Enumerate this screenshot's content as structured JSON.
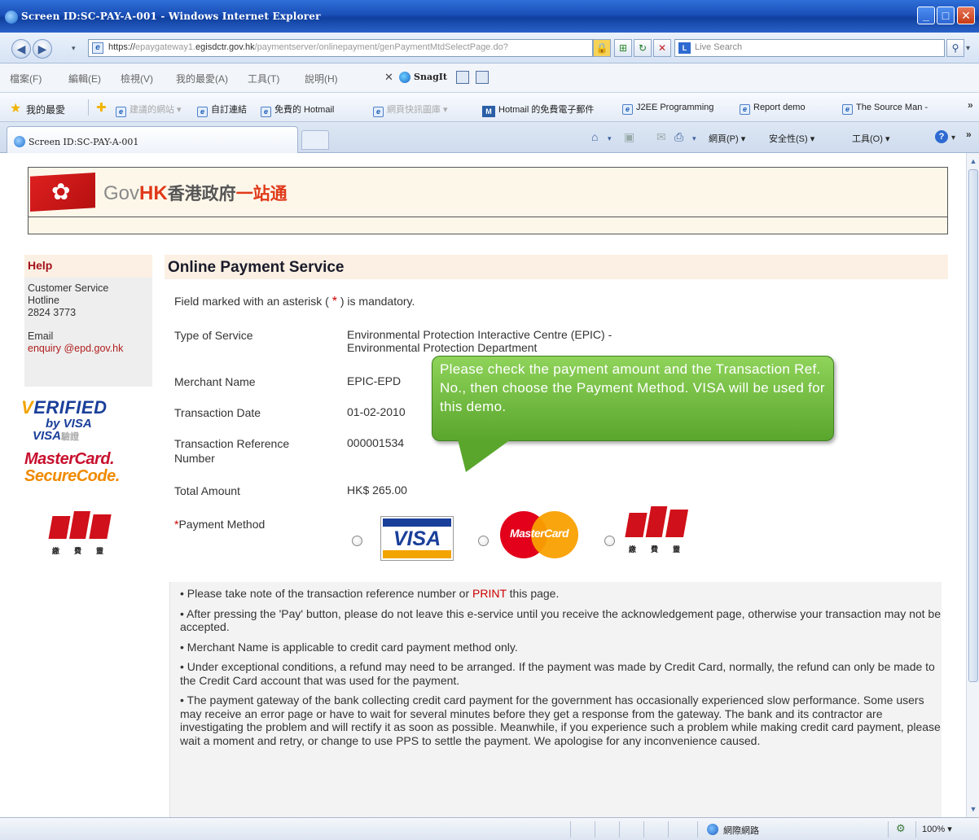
{
  "window": {
    "title": "Screen ID:SC-PAY-A-001 - Windows Internet Explorer"
  },
  "address_bar": {
    "url_prefix": "https://",
    "url_host_dim1": "epaygateway1.",
    "url_host": "egisdctr.gov.hk",
    "url_path": "/paymentserver/onlinepayment/genPaymentMtdSelectPage.do?",
    "search_placeholder": "Live Search"
  },
  "menu": {
    "items": [
      "檔案(F)",
      "編輯(E)",
      "檢視(V)",
      "我的最愛(A)",
      "工具(T)",
      "說明(H)"
    ],
    "snagit_label": "SnagIt"
  },
  "favorites": {
    "root": "我的最愛",
    "items": [
      {
        "label": "建議的網站 ▾",
        "faded": true
      },
      {
        "label": "自訂連結",
        "faded": false
      },
      {
        "label": "免費的 Hotmail",
        "faded": false
      },
      {
        "label": "網頁快訊圖庫 ▾",
        "faded": true
      },
      {
        "label": "Hotmail 的免費電子郵件",
        "faded": false
      },
      {
        "label": "J2EE Programming",
        "faded": false
      },
      {
        "label": "Report demo",
        "faded": false
      },
      {
        "label": "The Source Man -",
        "faded": false
      }
    ]
  },
  "tab": {
    "label": "Screen ID:SC-PAY-A-001"
  },
  "command_bar": {
    "page": "網頁(P) ▾",
    "safety": "安全性(S) ▾",
    "tools": "工具(O) ▾"
  },
  "banner": {
    "logo_gov": "Gov",
    "logo_hk": "HK",
    "logo_cn": "香港政府",
    "logo_cn2": "一站通"
  },
  "help": {
    "title": "Help",
    "hotline_label": "Customer Service Hotline",
    "hotline_number": "2824 3773",
    "email_label": "Email",
    "email": "enquiry @epd.gov.hk"
  },
  "badges": {
    "visa_1": "ERIFIED",
    "visa_2": "by VISA",
    "visa_3": "VISA",
    "visa_3_cn": "驗證",
    "mc_1": "MasterCard.",
    "mc_2": "SecureCode.",
    "pps_cn": [
      "繳",
      "費",
      "靈"
    ]
  },
  "main": {
    "title": "Online Payment Service",
    "mandatory_pre": "Field marked with an asterisk (",
    "mandatory_ast": "*",
    "mandatory_post": ") is mandatory.",
    "fields": {
      "service_label": "Type of Service",
      "service_value_1": "Environmental Protection Interactive Centre (EPIC) -",
      "service_value_2": "Environmental Protection Department",
      "merchant_label": "Merchant Name",
      "merchant_value": "EPIC-EPD",
      "date_label": "Transaction Date",
      "date_value": "01-02-2010",
      "ref_label": "Transaction Reference Number",
      "ref_value": "000001534",
      "amount_label": "Total Amount",
      "amount_value": "HK$ 265.00",
      "method_ast": "*",
      "method_label": "Payment Method"
    },
    "payment_methods": [
      {
        "name": "VISA",
        "selected": false
      },
      {
        "name": "MasterCard",
        "selected": false
      },
      {
        "name": "PPS",
        "selected": false
      }
    ]
  },
  "callout": {
    "text": "Please check the payment amount and the Transaction Ref. No., then choose the Payment Method. VISA will be used for this demo."
  },
  "notes": {
    "n1_pre": "• Please take note of the transaction reference number or ",
    "n1_print": "PRINT",
    "n1_post": " this page.",
    "n2": "• After pressing the 'Pay' button, please do not leave this e-service until you receive the acknowledgement page, otherwise your transaction may not be accepted.",
    "n3": "• Merchant Name is applicable to credit card payment method only.",
    "n4": "• Under exceptional conditions, a refund may need to be arranged. If the payment was made by Credit Card, normally, the refund can only be made to the Credit Card account that was used for the payment.",
    "n5": "• The payment gateway of the bank collecting credit card payment for the government has occasionally experienced slow performance. Some users may receive an error page or have to wait for several minutes before they get a response from the gateway. The bank and its contractor are investigating the problem and will rectify it as soon as possible. Meanwhile, if you experience such a problem while making credit card payment, please wait a moment and retry, or change to use PPS to settle the payment. We apologise for any inconvenience caused."
  },
  "status": {
    "zone": "網際網路",
    "zoom": "100% ▾"
  },
  "colors": {
    "accent_red": "#a3121a",
    "callout_green": "#5aa62d",
    "header_bg": "#fbf0e3"
  }
}
